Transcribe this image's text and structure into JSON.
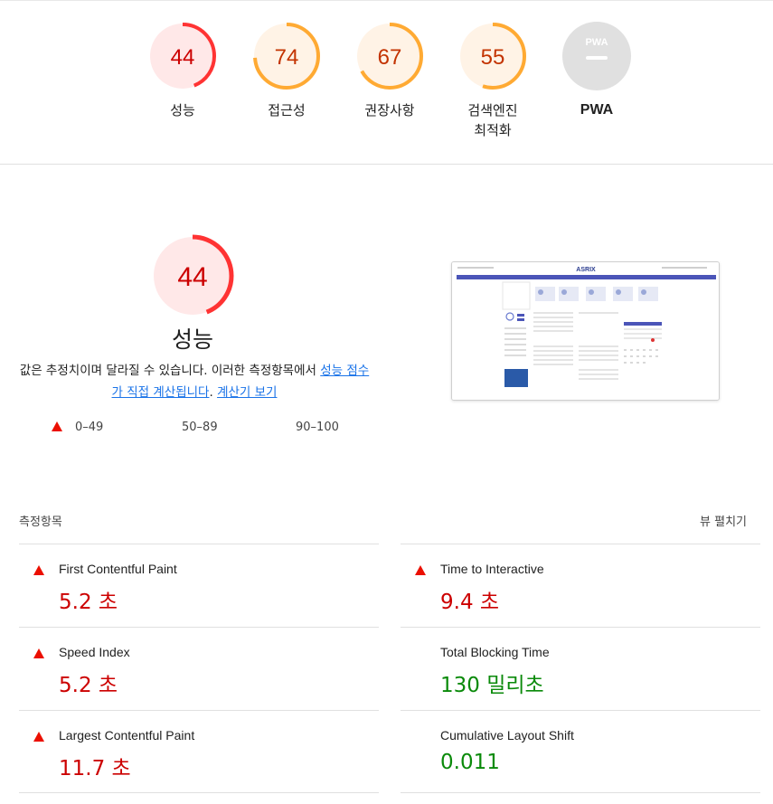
{
  "categories": [
    {
      "label": "성능",
      "score": "44",
      "score_num": 44,
      "color": "#ff3333",
      "bg": "#ffe8e8",
      "text_color": "#c00"
    },
    {
      "label": "접근성",
      "score": "74",
      "score_num": 74,
      "color": "#ffaa33",
      "bg": "#fff3e6",
      "text_color": "#c33300"
    },
    {
      "label": "권장사항",
      "score": "67",
      "score_num": 67,
      "color": "#ffaa33",
      "bg": "#fff3e6",
      "text_color": "#c33300"
    },
    {
      "label": "검색엔진\n최적화",
      "score": "55",
      "score_num": 55,
      "color": "#ffaa33",
      "bg": "#fff3e6",
      "text_color": "#c33300"
    },
    {
      "label": "PWA",
      "score": "",
      "score_num": 0,
      "color": "#e0e0e0",
      "bg": "#e0e0e0",
      "text_color": "#ffffff"
    }
  ],
  "pwa_badge": "PWA",
  "performance": {
    "score": "44",
    "score_num": 44,
    "title": "성능",
    "desc_text": "값은 추정치이며 달라질 수 있습니다. 이러한 측정항목에서 ",
    "desc_link1": "성능 점수가 직접 계산됩니다",
    "desc_sep": ". ",
    "desc_link2": "계산기 보기"
  },
  "legend": [
    {
      "label": "0–49",
      "icon": "triangle-icon"
    },
    {
      "label": "50–89",
      "icon": "square-icon"
    },
    {
      "label": "90–100",
      "icon": "circle-icon"
    }
  ],
  "screenshot": {
    "logo_text": "ASRIX"
  },
  "metrics_header": {
    "title": "측정항목",
    "expand": "뷰 펼치기"
  },
  "metrics": [
    {
      "name": "First Contentful Paint",
      "value": "5.2 초",
      "status": "fail"
    },
    {
      "name": "Time to Interactive",
      "value": "9.4 초",
      "status": "fail"
    },
    {
      "name": "Speed Index",
      "value": "5.2 초",
      "status": "fail"
    },
    {
      "name": "Total Blocking Time",
      "value": "130 밀리초",
      "status": "pass"
    },
    {
      "name": "Largest Contentful Paint",
      "value": "11.7 초",
      "status": "fail"
    },
    {
      "name": "Cumulative Layout Shift",
      "value": "0.011",
      "status": "pass"
    }
  ]
}
